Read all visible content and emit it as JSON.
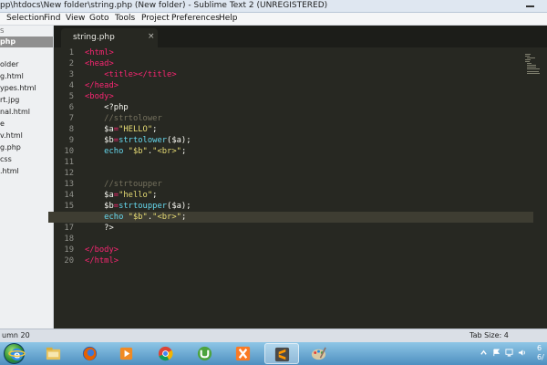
{
  "window": {
    "title": "pp\\htdocs\\New folder\\string.php (New folder) - Sublime Text 2 (UNREGISTERED)"
  },
  "menu": [
    "Selection",
    "Find",
    "View",
    "Goto",
    "Tools",
    "Project",
    "Preferences",
    "Help"
  ],
  "sidebar": {
    "items": [
      "S",
      "php",
      "",
      "older",
      "g.html",
      "ypes.html",
      "rt.jpg",
      "nal.html",
      "e",
      "v.html",
      "g.php",
      "css",
      ".html"
    ]
  },
  "tab": {
    "label": "string.php",
    "close": "×"
  },
  "editor": {
    "line_numbers": [
      "1",
      "2",
      "3",
      "4",
      "5",
      "6",
      "7",
      "8",
      "9",
      "10",
      "11",
      "12",
      "13",
      "14",
      "15",
      "16",
      "17",
      "18",
      "19",
      "20"
    ],
    "lines": [
      {
        "tokens": [
          [
            "t",
            "<html>"
          ]
        ]
      },
      {
        "tokens": [
          [
            "t",
            "<head>"
          ]
        ]
      },
      {
        "tokens": [
          [
            "p",
            "    "
          ],
          [
            "t",
            "<title></title>"
          ]
        ]
      },
      {
        "tokens": [
          [
            "t",
            "</head>"
          ]
        ]
      },
      {
        "tokens": [
          [
            "t",
            "<body>"
          ]
        ]
      },
      {
        "tokens": [
          [
            "p",
            "    <?php"
          ]
        ]
      },
      {
        "tokens": [
          [
            "c",
            "    //strtolower"
          ]
        ]
      },
      {
        "tokens": [
          [
            "v",
            "    $a"
          ],
          [
            "o",
            "="
          ],
          [
            "s",
            "\"HELLO\""
          ],
          [
            "p",
            ";"
          ]
        ]
      },
      {
        "tokens": [
          [
            "v",
            "    $b"
          ],
          [
            "o",
            "="
          ],
          [
            "f",
            "strtolower"
          ],
          [
            "p",
            "($a);"
          ]
        ]
      },
      {
        "tokens": [
          [
            "k",
            "    echo "
          ],
          [
            "s",
            "\"$b\""
          ],
          [
            "p",
            "."
          ],
          [
            "s",
            "\"<br>\""
          ],
          [
            "p",
            ";"
          ]
        ]
      },
      {
        "tokens": []
      },
      {
        "tokens": []
      },
      {
        "tokens": []
      },
      {
        "tokens": [
          [
            "c",
            "    //strtoupper"
          ]
        ]
      },
      {
        "tokens": [
          [
            "v",
            "    $a"
          ],
          [
            "o",
            "="
          ],
          [
            "s",
            "\"hello\""
          ],
          [
            "p",
            ";"
          ]
        ]
      },
      {
        "tokens": [
          [
            "v",
            "    $b"
          ],
          [
            "o",
            "="
          ],
          [
            "f",
            "strtoupper"
          ],
          [
            "p",
            "($a);"
          ]
        ]
      },
      {
        "tokens": [
          [
            "k",
            "    echo "
          ],
          [
            "s",
            "\"$b\""
          ],
          [
            "p",
            "."
          ],
          [
            "s",
            "\"<br>\""
          ],
          [
            "p",
            ";"
          ]
        ]
      },
      {
        "tokens": [
          [
            "p",
            "    ?>"
          ]
        ]
      },
      {
        "tokens": []
      },
      {
        "tokens": [
          [
            "t",
            "</body>"
          ]
        ]
      },
      {
        "tokens": [
          [
            "t",
            "</html>"
          ]
        ]
      }
    ],
    "active_line": 16
  },
  "status": {
    "left": "umn 20",
    "right": "Tab Size: 4"
  },
  "taskbar": {
    "apps": [
      "internet-explorer-icon",
      "file-explorer-icon",
      "firefox-icon",
      "media-player-icon",
      "chrome-icon",
      "utorrent-icon",
      "xampp-icon",
      "sublime-text-icon",
      "paint-icon"
    ],
    "active_app": "sublime-text-icon",
    "clock": "6\n6/"
  },
  "colors": {
    "editor_bg": "#272822",
    "tag": "#f92672",
    "string": "#e6db74",
    "func": "#66d9ef",
    "comment": "#75715e"
  }
}
